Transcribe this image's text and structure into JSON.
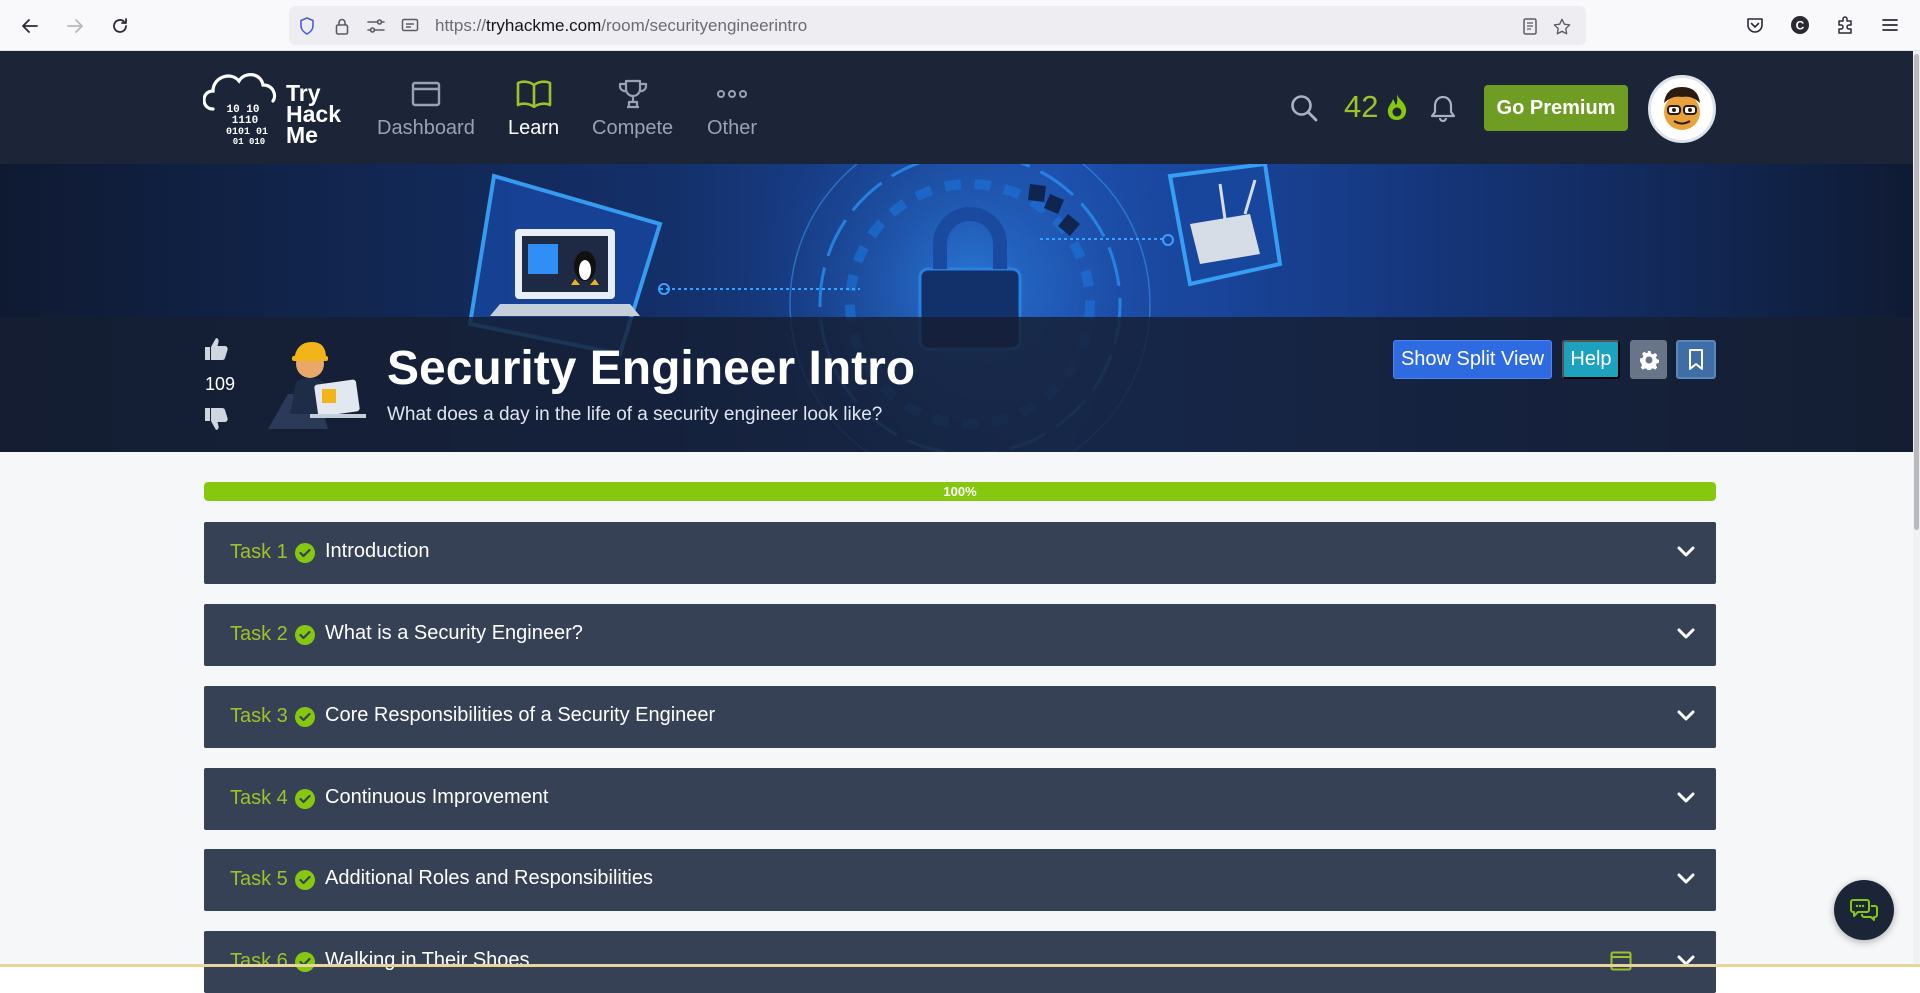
{
  "browser": {
    "url_host": "tryhackme.com",
    "url_scheme": "https://",
    "url_path": "/room/securityengineerintro"
  },
  "header": {
    "logo_text": [
      "Try",
      "Hack",
      "Me"
    ],
    "logo_bits": [
      "10 10",
      "1110",
      "0101 01",
      "01 010"
    ],
    "nav": [
      {
        "label": "Dashboard",
        "icon": "dashboard-icon",
        "active": false
      },
      {
        "label": "Learn",
        "icon": "book-icon",
        "active": true
      },
      {
        "label": "Compete",
        "icon": "trophy-icon",
        "active": false
      },
      {
        "label": "Other",
        "icon": "more-dots-icon",
        "active": false
      }
    ],
    "streak_count": "42",
    "premium_label": "Go Premium"
  },
  "room": {
    "title": "Security Engineer Intro",
    "description": "What does a day in the life of a security engineer look like?",
    "votes": "109",
    "split_view_label": "Show Split View",
    "help_label": "Help"
  },
  "progress": {
    "percent_label": "100%",
    "value": 100
  },
  "tasks": [
    {
      "number": "Task 1",
      "title": "Introduction"
    },
    {
      "number": "Task 2",
      "title": "What is a Security Engineer?"
    },
    {
      "number": "Task 3",
      "title": "Core Responsibilities of a Security Engineer"
    },
    {
      "number": "Task 4",
      "title": "Continuous Improvement"
    },
    {
      "number": "Task 5",
      "title": "Additional Roles and Responsibilities"
    },
    {
      "number": "Task 6",
      "title": "Walking in Their Shoes"
    }
  ],
  "colors": {
    "header_bg": "#1c2538",
    "accent_green": "#86c80f",
    "task_bg": "#374155",
    "split_view_blue": "#2f6be0",
    "help_teal": "#1da1bf",
    "premium_green": "#6f9d23"
  }
}
